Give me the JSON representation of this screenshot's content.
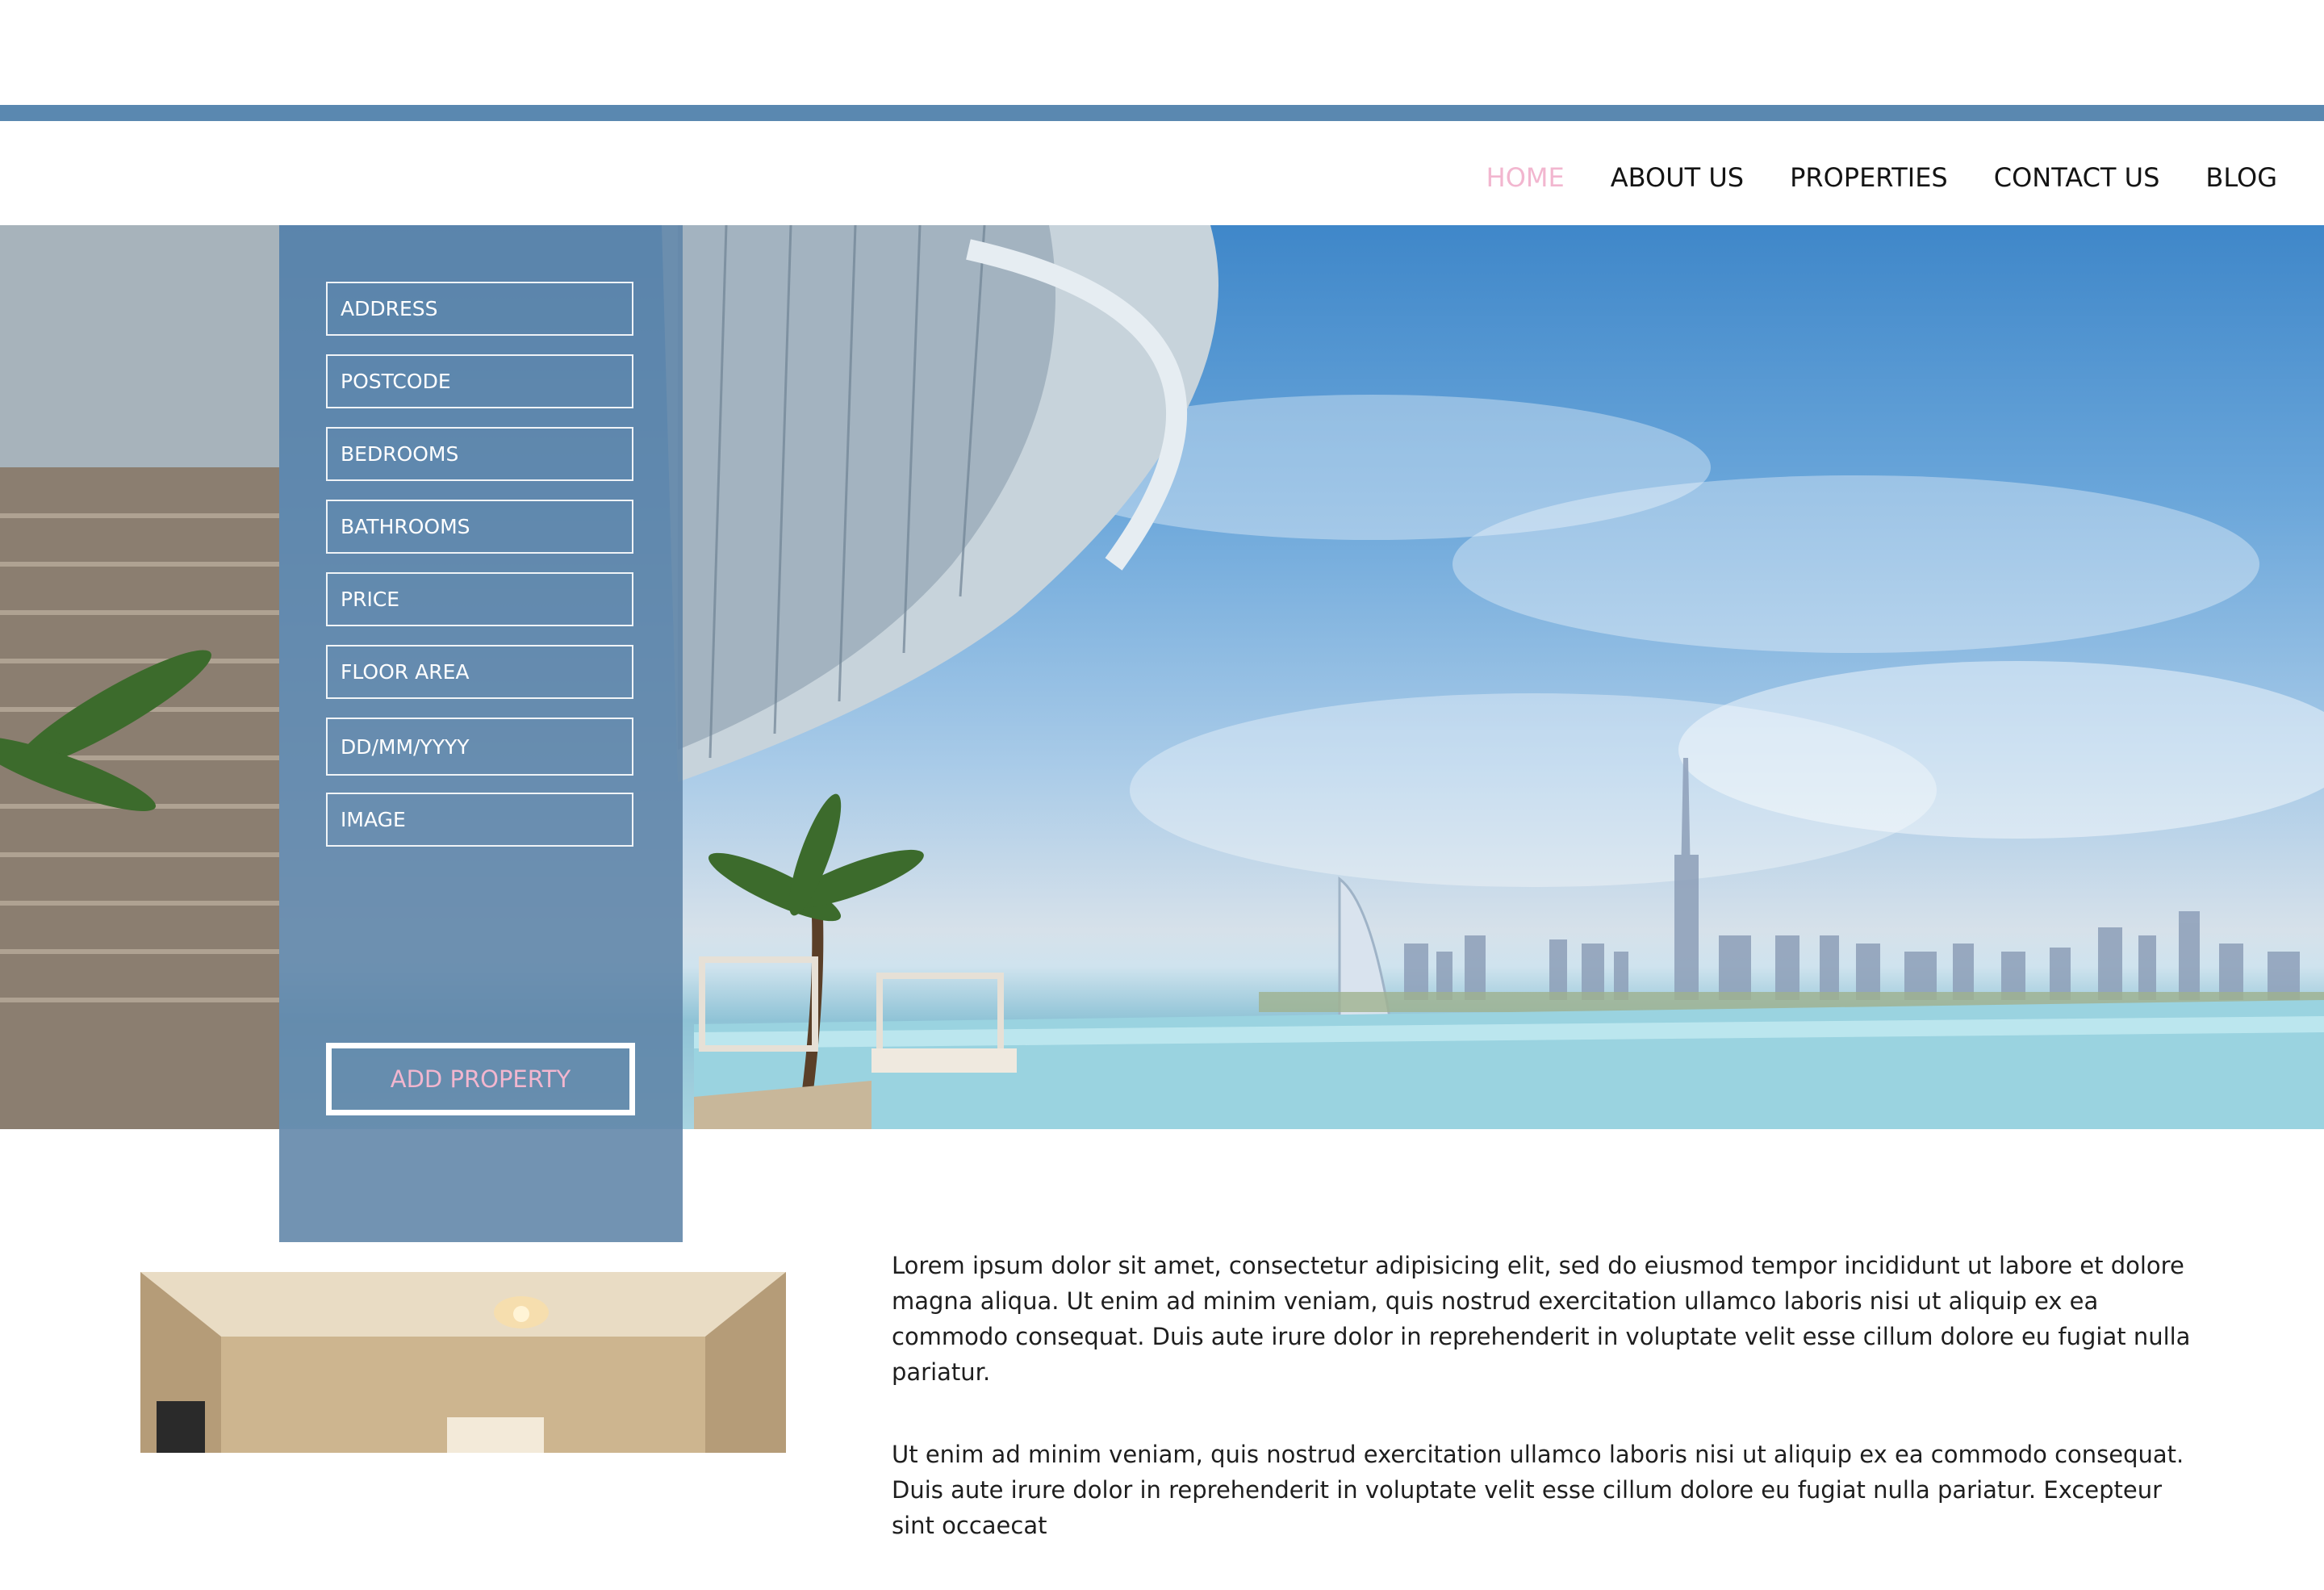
{
  "nav": {
    "items": [
      {
        "label": "HOME",
        "active": true
      },
      {
        "label": "ABOUT US",
        "active": false
      },
      {
        "label": "PROPERTIES",
        "active": false
      },
      {
        "label": "CONTACT US",
        "active": false
      },
      {
        "label": "BLOG",
        "active": false
      }
    ]
  },
  "form": {
    "address_placeholder": "ADDRESS",
    "postcode_placeholder": "POSTCODE",
    "bedrooms_placeholder": "BEDROOMS",
    "bathrooms_placeholder": "BATHROOMS",
    "price_placeholder": "PRICE",
    "floor_area_placeholder": "FLOOR AREA",
    "date_placeholder": "DD/MM/YYYY",
    "image_placeholder": "IMAGE",
    "submit_label": "ADD PROPERTY"
  },
  "content": {
    "paragraph_1": "Lorem ipsum dolor sit amet, consectetur adipisicing elit, sed do eiusmod tempor incididunt ut labore et dolore magna aliqua. Ut enim ad minim veniam, quis nostrud exercitation ullamco laboris nisi ut aliquip ex ea commodo consequat. Duis aute irure dolor in reprehenderit in voluptate velit esse cillum dolore eu fugiat nulla pariatur.",
    "paragraph_2": "Ut enim ad minim veniam, quis nostrud exercitation ullamco laboris nisi ut aliquip ex ea commodo consequat. Duis aute irure dolor in reprehenderit in voluptate velit esse cillum dolore eu fugiat nulla pariatur. Excepteur sint occaecat"
  },
  "colors": {
    "accent_bar": "#5a88b0",
    "active_nav": "#f2b6cf",
    "form_panel": "#5f84a7"
  }
}
